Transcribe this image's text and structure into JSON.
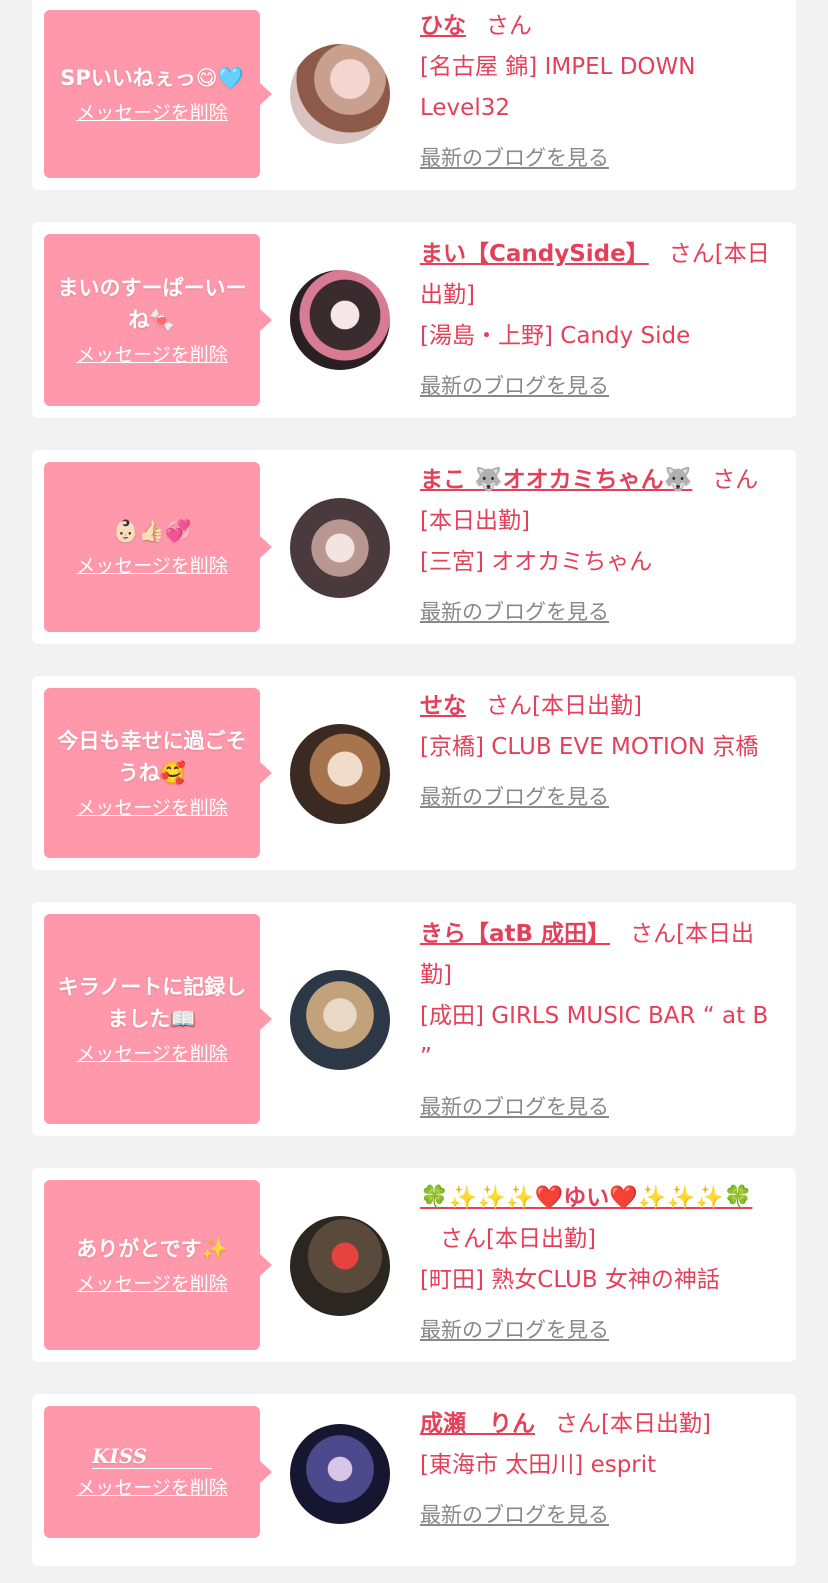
{
  "delete_label": "メッセージを削除",
  "san_label": "さん",
  "blog_label": "最新のブログを見る",
  "theme": {
    "bubble_color": "#fe98aa",
    "text_pink": "#e4405a",
    "link_gray": "#888888",
    "background": "#f2f2f2"
  },
  "entries": [
    {
      "message": "SPいいねぇっ😋🩵",
      "name": "ひな",
      "working": "",
      "shop": "[名古屋 錦] IMPEL DOWN Level32",
      "avatar_icon": "profile-photo"
    },
    {
      "message": "まいのすーぱーいーね🍬",
      "name": "まい【CandySide】",
      "working": "[本日出勤]",
      "shop": "[湯島・上野] Candy Side",
      "avatar_icon": "profile-photo"
    },
    {
      "message": "👶🏻👍🏻💞",
      "name": "まこ 🐺オオカミちゃん🐺",
      "working": "[本日出勤]",
      "shop": "[三宮] オオカミちゃん",
      "avatar_icon": "profile-photo"
    },
    {
      "message": "今日も幸せに過ごそうね🥰",
      "name": "せな",
      "working": "[本日出勤]",
      "shop": "[京橋] CLUB EVE MOTION 京橋",
      "avatar_icon": "profile-photo"
    },
    {
      "message": "キラノートに記録しました📖",
      "name": "きら【atB 成田】",
      "working": "[本日出勤]",
      "shop": "[成田] GIRLS MUSIC BAR “ at B ”",
      "avatar_icon": "profile-photo"
    },
    {
      "message": "ありがとです✨",
      "name": "🍀✨✨✨❤️ゆい❤️✨✨✨🍀",
      "working": "[本日出勤]",
      "shop": "[町田] 熟女CLUB 女神の神話",
      "avatar_icon": "profile-photo"
    },
    {
      "message": "KISS",
      "name": "成瀬　りん",
      "working": "[本日出勤]",
      "shop": "[東海市 太田川] esprit",
      "avatar_icon": "profile-photo"
    }
  ]
}
